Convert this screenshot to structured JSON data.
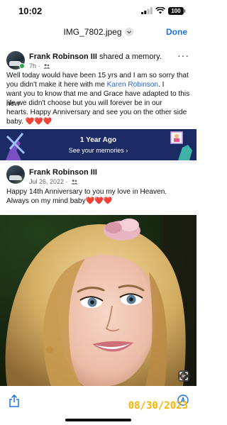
{
  "status": {
    "time": "10:02",
    "battery": "100"
  },
  "viewer": {
    "file_name": "IMG_7802.jpeg",
    "done_label": "Done"
  },
  "post1": {
    "author": "Frank Robinson III",
    "action": " shared a memory.",
    "time": "7h · ",
    "body_lines": [
      "Well today would have been 15 yrs and I am so sorry that",
      "you didn't make it here with me ",
      "want you to know that me and Grace have adapted to this new",
      "life we didn't choose but you will forever be in our",
      "hearts. Happy Anniversary and see you on the other side",
      "baby. ❤️❤️❤️"
    ],
    "tagged": "Karen Robinson",
    "after_tag": ". I",
    "more": "···"
  },
  "memory": {
    "title": "1 Year Ago",
    "link": "See your memories ›"
  },
  "post2": {
    "author": "Frank Robinson III",
    "date": "Jul 26, 2022 · ",
    "body_lines": [
      "Happy 14th Anniversary to you my love in Heaven.",
      "Always on my mind baby❤️❤️❤️"
    ]
  },
  "overlay": {
    "date_stamp": "08/30/2023"
  }
}
